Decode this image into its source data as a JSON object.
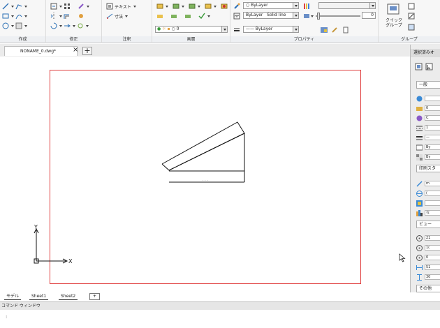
{
  "ribbon": {
    "panels": {
      "draw": "作成",
      "modify": "修正",
      "annotation": "注釈",
      "layer": "画層",
      "properties": "プロパティ",
      "group": "グループ"
    },
    "text_tool": "テキスト",
    "dim_tool": "寸法",
    "quick_group": "クイック\nグループ",
    "layer_combo": "0",
    "color_combo": "ByLayer",
    "linetype_layer": "ByLayer",
    "linetype_solid": "Solid line",
    "lineweight_combo": "—— ByLayer",
    "slider_value": "0"
  },
  "doc_tab": {
    "name": "NONAME_0.dwg*",
    "close": "×",
    "new": "+"
  },
  "drawing": {
    "slope_label": "—·—·",
    "base_label": "·  ·  ·",
    "ucs": {
      "x": "X",
      "y": "Y"
    }
  },
  "palette": {
    "header": "選択済みオ",
    "sections": {
      "general": "一般",
      "print_style": "印刷スタ",
      "view": "ビュー",
      "misc": "その他"
    },
    "general_rows": [
      "",
      "0",
      "C",
      "1",
      "—",
      "By",
      "By"
    ],
    "print_rows": [
      "m",
      "(",
      "",
      "な"
    ],
    "view_rows": [
      "21",
      "1(",
      "0",
      "51",
      "30"
    ]
  },
  "layout_tabs": [
    "モデル",
    "Sheet1",
    "Sheet2",
    "+"
  ],
  "command_window": {
    "title": "コマンド ウィンドウ",
    "prompt": ":"
  }
}
